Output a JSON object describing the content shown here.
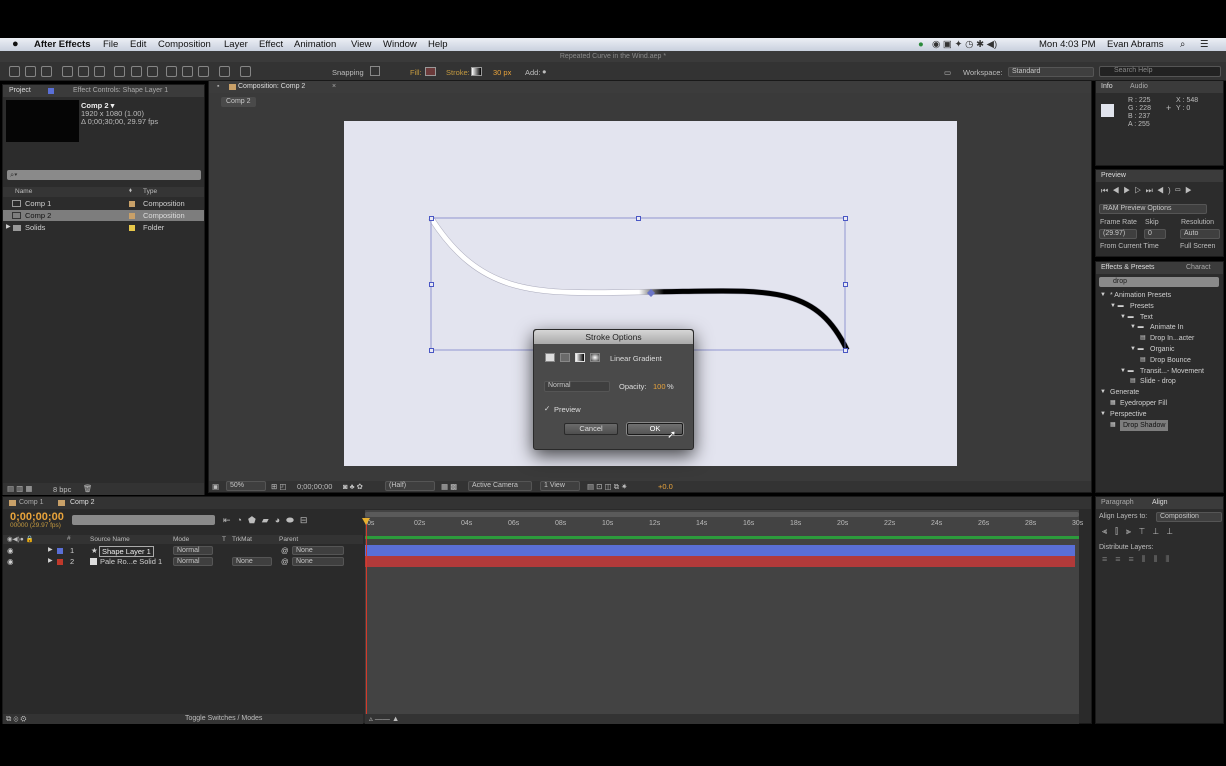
{
  "menubar": {
    "app_name": "After Effects",
    "items": [
      "File",
      "Edit",
      "Composition",
      "Layer",
      "Effect",
      "Animation",
      "View",
      "Window",
      "Help"
    ],
    "status_text": "Mon 4:03 PM",
    "user": "Evan Abrams"
  },
  "window_title": "Repeated Curve in the Wind.aep *",
  "toolbar": {
    "snapping": "Snapping",
    "fill_label": "Fill:",
    "stroke_label": "Stroke:",
    "stroke_width": "30 px",
    "add_label": "Add:",
    "workspace_label": "Workspace:",
    "workspace_value": "Standard",
    "search_placeholder": "Search Help"
  },
  "project_panel": {
    "tab_project": "Project",
    "tab_effect_controls": "Effect Controls: Shape Layer 1",
    "comp_name": "Comp 2 ▾",
    "comp_size": "1920 x 1080 (1.00)",
    "comp_duration": "Δ 0;00;30;00, 29.97 fps",
    "col_name": "Name",
    "col_type": "Type",
    "items": [
      {
        "name": "Comp 1",
        "type": "Composition"
      },
      {
        "name": "Comp 2",
        "type": "Composition"
      },
      {
        "name": "Solids",
        "type": "Folder"
      }
    ],
    "bpc": "8 bpc"
  },
  "composition": {
    "tab": "Composition: Comp 2",
    "breadcrumb": "Comp 2",
    "zoom": "50%",
    "timecode": "0;00;00;00",
    "resolution": "(Half)",
    "camera": "Active Camera",
    "views": "1 View",
    "exposure": "+0.0"
  },
  "stroke_dialog": {
    "title": "Stroke Options",
    "gradient_type": "Linear Gradient",
    "blend_mode": "Normal",
    "opacity_label": "Opacity:",
    "opacity_value": "100",
    "opacity_unit": "%",
    "preview_label": "Preview",
    "preview_checked": true,
    "cancel_label": "Cancel",
    "ok_label": "OK"
  },
  "info_panel": {
    "tab_info": "Info",
    "tab_audio": "Audio",
    "r": "R : 225",
    "g": "G : 228",
    "b": "B : 237",
    "a": "A : 255",
    "x": "X : 548",
    "y": "Y : 0"
  },
  "preview_panel": {
    "tab": "Preview",
    "ram_options": "RAM Preview Options",
    "frame_rate_label": "Frame Rate",
    "skip_label": "Skip",
    "resolution_label": "Resolution",
    "frame_rate_value": "(29.97)",
    "skip_value": "0",
    "resolution_value": "Auto",
    "from_current": "From Current Time",
    "full_screen": "Full Screen"
  },
  "effects_panel": {
    "tab": "Effects & Presets",
    "tab2": "Charact",
    "search_value": "drop",
    "tree": [
      {
        "label": "* Animation Presets",
        "indent": 0,
        "kind": "toggle"
      },
      {
        "label": "Presets",
        "indent": 1,
        "kind": "folder"
      },
      {
        "label": "Text",
        "indent": 2,
        "kind": "folder"
      },
      {
        "label": "Animate In",
        "indent": 3,
        "kind": "folder"
      },
      {
        "label": "Drop In...acter",
        "indent": 4,
        "kind": "file"
      },
      {
        "label": "Organic",
        "indent": 3,
        "kind": "folder"
      },
      {
        "label": "Drop Bounce",
        "indent": 4,
        "kind": "file"
      },
      {
        "label": "Transit...- Movement",
        "indent": 2,
        "kind": "folder"
      },
      {
        "label": "Slide - drop",
        "indent": 3,
        "kind": "file"
      },
      {
        "label": "Generate",
        "indent": 0,
        "kind": "toggle"
      },
      {
        "label": "Eyedropper Fill",
        "indent": 1,
        "kind": "effect"
      },
      {
        "label": "Perspective",
        "indent": 0,
        "kind": "toggle"
      },
      {
        "label": "Drop Shadow",
        "indent": 1,
        "kind": "effect-selected"
      }
    ]
  },
  "timeline": {
    "tab_comp1": "Comp 1",
    "tab_comp2": "Comp 2",
    "timecode": "0;00;00;00",
    "frame_info": "00000 (29.97 fps)",
    "col_source": "Source Name",
    "col_mode": "Mode",
    "col_t": "T",
    "col_trkmat": "TrkMat",
    "col_parent": "Parent",
    "layers": [
      {
        "num": "1",
        "name": "Shape Layer 1",
        "mode": "Normal",
        "trkmat": "",
        "parent": "None",
        "color": "#5a6fd6"
      },
      {
        "num": "2",
        "name": "Pale Ro...e Solid 1",
        "mode": "Normal",
        "trkmat": "None",
        "parent": "None",
        "color": "#c0392b"
      }
    ],
    "ruler": [
      "0s",
      "02s",
      "04s",
      "06s",
      "08s",
      "10s",
      "12s",
      "14s",
      "16s",
      "18s",
      "20s",
      "22s",
      "24s",
      "26s",
      "28s",
      "30s"
    ],
    "toggle_label": "Toggle Switches / Modes"
  },
  "paragraph_panel": {
    "tab_paragraph": "Paragraph",
    "tab_align": "Align",
    "align_to_label": "Align Layers to:",
    "align_to_value": "Composition",
    "distribute_label": "Distribute Layers:"
  }
}
